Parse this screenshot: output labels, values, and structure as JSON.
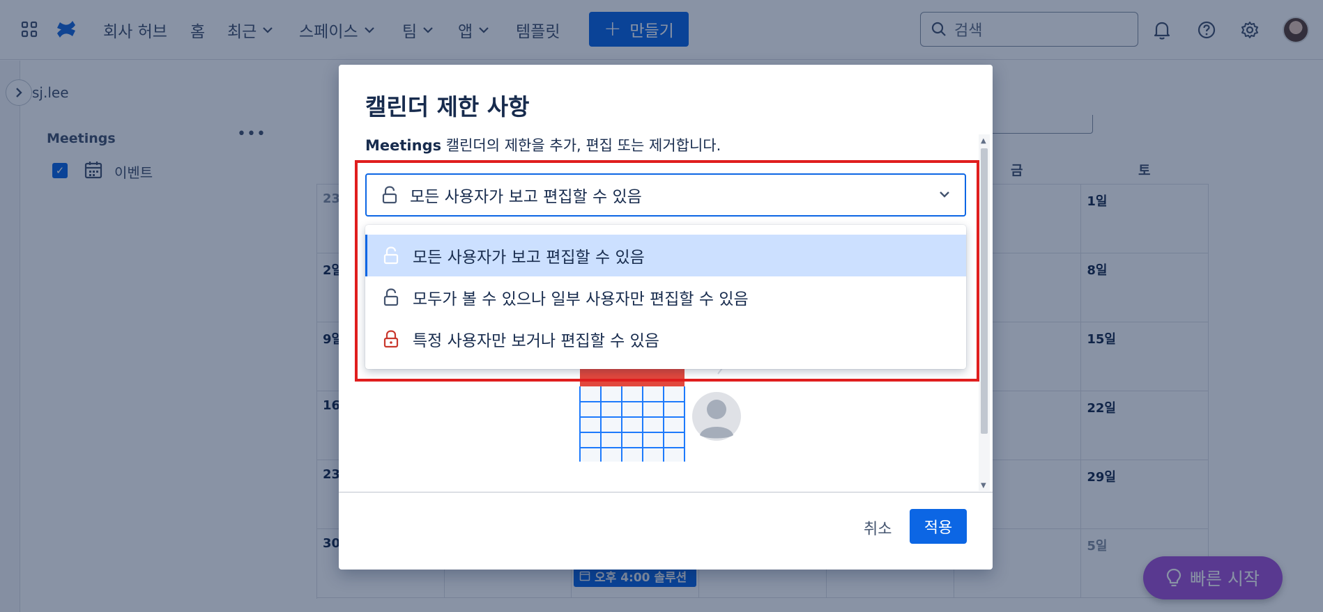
{
  "nav": {
    "items": [
      {
        "label": "회사 허브",
        "has_chevron": false
      },
      {
        "label": "홈",
        "has_chevron": false
      },
      {
        "label": "최근",
        "has_chevron": true
      },
      {
        "label": "스페이스",
        "has_chevron": true
      },
      {
        "label": "팀",
        "has_chevron": true
      },
      {
        "label": "앱",
        "has_chevron": true
      },
      {
        "label": "템플릿",
        "has_chevron": false
      }
    ],
    "create_label": "만들기",
    "search_placeholder": "검색",
    "icons": [
      "apps-grid-icon",
      "confluence-logo-icon",
      "bell-icon",
      "help-icon",
      "settings-icon"
    ]
  },
  "sidebar": {
    "space_name": "sj.lee",
    "section_title": "Meetings",
    "calendar_item": "이벤트"
  },
  "calendar": {
    "weekdays_visible": [
      "금",
      "토"
    ],
    "rows": [
      [
        "23",
        "",
        "",
        "",
        "",
        "",
        "1일"
      ],
      [
        "2일",
        "",
        "",
        "",
        "",
        "",
        "8일"
      ],
      [
        "9일",
        "",
        "",
        "",
        "",
        "",
        "15일"
      ],
      [
        "16",
        "",
        "",
        "",
        "",
        "",
        "22일"
      ],
      [
        "23",
        "",
        "",
        "",
        "",
        "",
        "29일"
      ],
      [
        "30",
        "",
        "",
        "",
        "",
        "",
        "5일"
      ]
    ],
    "event_chip": "오후 4:00 솔루션"
  },
  "quick_start": "빠른 시작",
  "modal": {
    "title": "캘린더 제한 사항",
    "desc_bold": "Meetings",
    "desc_rest": " 캘린더의 제한을 추가, 편집 또는 제거합니다.",
    "select_value": "모든 사용자가 보고 편집할 수 있음",
    "options": [
      {
        "label": "모든 사용자가 보고 편집할 수 있음",
        "icon": "unlock-icon",
        "selected": true
      },
      {
        "label": "모두가 볼 수 있으나 일부 사용자만 편집할 수 있음",
        "icon": "unlock-icon",
        "selected": false
      },
      {
        "label": "특정 사용자만 보거나 편집할 수 있음",
        "icon": "lock-icon",
        "selected": false
      }
    ],
    "cancel_label": "취소",
    "apply_label": "적용"
  },
  "colors": {
    "primary": "#0c66e4",
    "highlight_border": "#e01e1e",
    "lock_red": "#c9372c",
    "quick_start": "#a354d6"
  }
}
